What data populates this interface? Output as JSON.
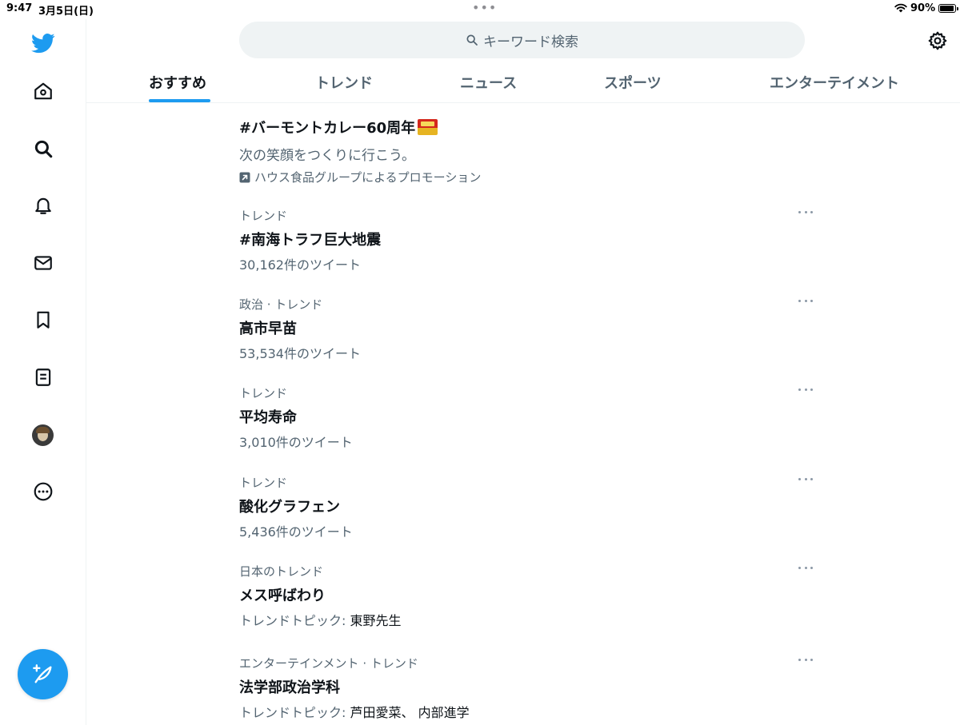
{
  "status_bar": {
    "time": "9:47",
    "date": "3月5日(日)",
    "multitask_dots": "•••",
    "battery_percent": "90%"
  },
  "sidebar": {
    "icons": [
      "twitter-logo-icon",
      "home-icon",
      "search-icon",
      "bell-icon",
      "mail-icon",
      "bookmark-icon",
      "lists-icon",
      "avatar",
      "more-circle-icon"
    ],
    "compose_icon": "feather-plus-icon"
  },
  "search": {
    "label": "キーワード検索",
    "icon": "search-icon"
  },
  "tabs": [
    {
      "label": "おすすめ",
      "active": true
    },
    {
      "label": "トレンド",
      "active": false
    },
    {
      "label": "ニュース",
      "active": false
    },
    {
      "label": "スポーツ",
      "active": false
    },
    {
      "label": "エンターテイメント",
      "active": false
    }
  ],
  "promo": {
    "title": "#バーモントカレー60周年",
    "subtitle": "次の笑顔をつくりに行こう。",
    "byline": "ハウス食品グループによるプロモーション"
  },
  "trends": [
    {
      "meta": "トレンド",
      "name": "#南海トラフ巨大地震",
      "count": "30,162件のツイート"
    },
    {
      "meta": "政治 · トレンド",
      "name": "高市早苗",
      "count": "53,534件のツイート"
    },
    {
      "meta": "トレンド",
      "name": "平均寿命",
      "count": "3,010件のツイート"
    },
    {
      "meta": "トレンド",
      "name": "酸化グラフェン",
      "count": "5,436件のツイート"
    },
    {
      "meta": "日本のトレンド",
      "name": "メス呼ばわり",
      "count_label": "トレンドトピック: ",
      "count_topic": "東野先生"
    },
    {
      "meta": "エンターテインメント · トレンド",
      "name": "法学部政治学科",
      "count_label": "トレンドトピック: ",
      "count_topic": "芦田愛菜、 内部進学"
    }
  ],
  "colors": {
    "accent": "#1d9bf0",
    "secondary_text": "#536471",
    "primary_text": "#0f1419",
    "search_bg": "#eff3f4"
  }
}
